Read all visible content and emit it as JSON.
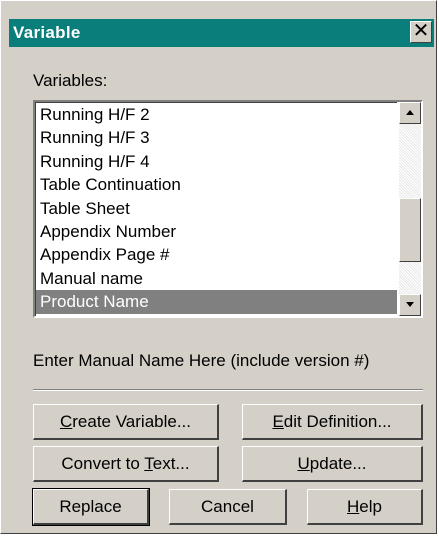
{
  "dialog": {
    "title": "Variable",
    "close_glyph": "✕"
  },
  "variables_label": "Variables:",
  "list": {
    "items": [
      "Running H/F 2",
      "Running H/F 3",
      "Running H/F 4",
      "Table Continuation",
      "Table Sheet",
      "Appendix Number",
      "Appendix Page #",
      "Manual name",
      "Product Name"
    ],
    "selected_index": 8
  },
  "scroll_position": 0.7,
  "description": "Enter Manual Name Here (include version #)",
  "buttons": {
    "create_variable": {
      "prefix": "",
      "mnemonic": "C",
      "rest": "reate Variable..."
    },
    "edit_definition": {
      "prefix": "",
      "mnemonic": "E",
      "rest": "dit Definition..."
    },
    "convert_to_text": {
      "prefix": "Convert to ",
      "mnemonic": "T",
      "rest": "ext..."
    },
    "update": {
      "prefix": "",
      "mnemonic": "U",
      "rest": "pdate..."
    },
    "replace": "Replace",
    "cancel": "Cancel",
    "help": {
      "prefix": "",
      "mnemonic": "H",
      "rest": "elp"
    }
  },
  "colors": {
    "titlebar": "#0a7e7a",
    "selection": "#808080",
    "face": "#d4d0c8"
  },
  "icons": {
    "close": "close-icon",
    "scroll_up": "scroll-up-arrow-icon",
    "scroll_down": "scroll-down-arrow-icon"
  }
}
